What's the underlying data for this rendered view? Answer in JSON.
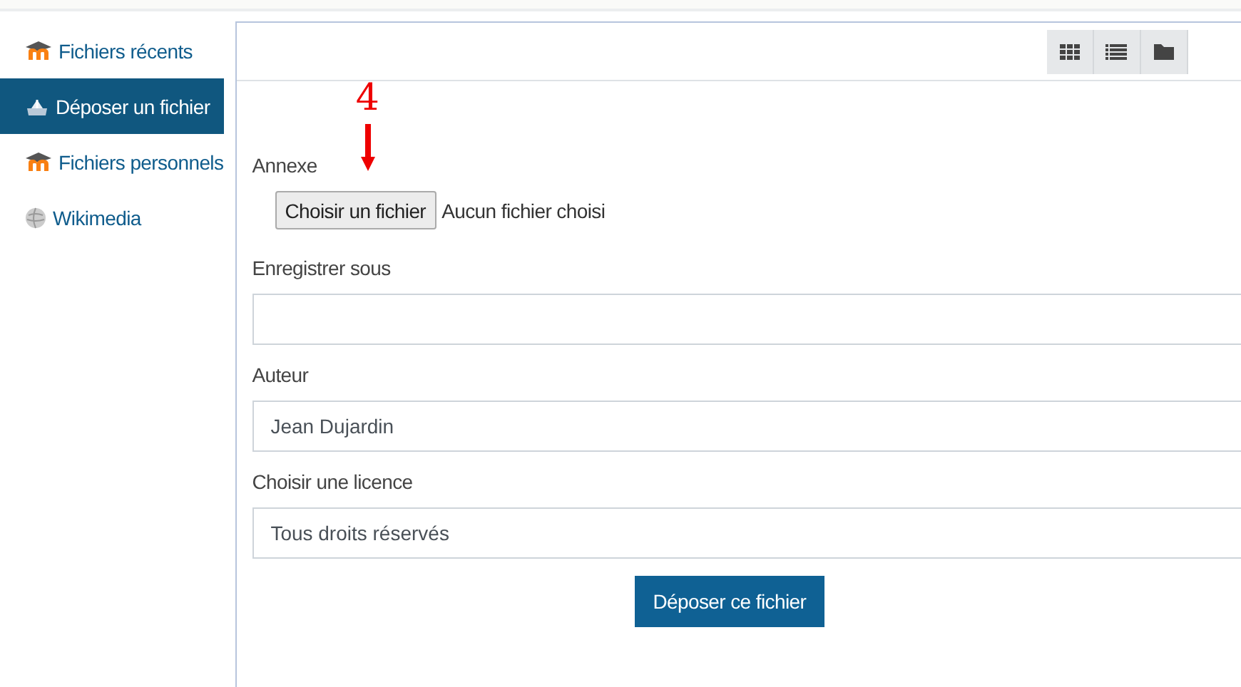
{
  "sidebar": {
    "items": [
      {
        "label": "Fichiers récents",
        "selected": false,
        "kind": "moodle"
      },
      {
        "label": "Déposer un fichier",
        "selected": true,
        "kind": "upload"
      },
      {
        "label": "Fichiers personnels",
        "selected": false,
        "kind": "moodle"
      },
      {
        "label": "Wikimedia",
        "selected": false,
        "kind": "wiki"
      }
    ]
  },
  "toolbar": {
    "buttons": [
      {
        "kind": "grid"
      },
      {
        "kind": "list"
      },
      {
        "kind": "folder"
      }
    ]
  },
  "annotation": {
    "number": "4"
  },
  "form": {
    "fields": [
      {
        "kind": "file",
        "label": "Annexe",
        "button": "Choisir un fichier",
        "status": "Aucun fichier choisi"
      },
      {
        "kind": "text",
        "label": "Enregistrer sous"
      },
      {
        "kind": "text",
        "label": "Auteur",
        "value": "Jean Dujardin"
      },
      {
        "kind": "select",
        "label": "Choisir une licence",
        "value": "Tous droits réservés"
      }
    ],
    "submit": "Déposer ce fichier"
  }
}
